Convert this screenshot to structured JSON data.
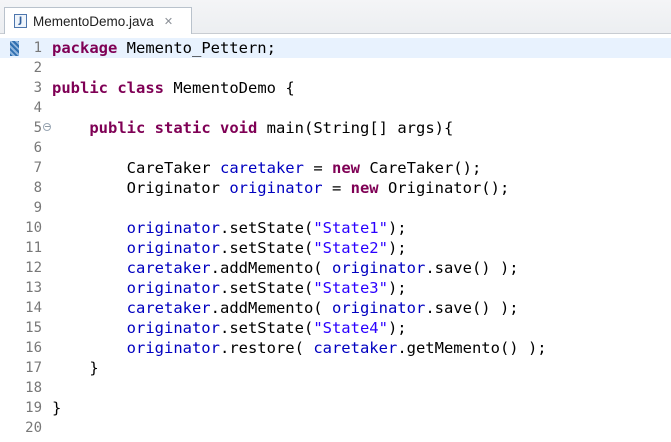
{
  "tab": {
    "icon_letter": "J",
    "title": "MementoDemo.java",
    "close_glyph": "✕"
  },
  "editor": {
    "current_line": 1,
    "fold_glyph": "⊖",
    "lines": [
      {
        "num": "1",
        "tokens": [
          {
            "t": "package",
            "c": "kw"
          },
          {
            "t": " Memento_Pettern;",
            "c": ""
          }
        ]
      },
      {
        "num": "2",
        "tokens": []
      },
      {
        "num": "3",
        "tokens": [
          {
            "t": "public",
            "c": "kw"
          },
          {
            "t": " ",
            "c": ""
          },
          {
            "t": "class",
            "c": "kw"
          },
          {
            "t": " MementoDemo {",
            "c": ""
          }
        ]
      },
      {
        "num": "4",
        "tokens": []
      },
      {
        "num": "5",
        "fold": true,
        "tokens": [
          {
            "t": "    ",
            "c": ""
          },
          {
            "t": "public",
            "c": "kw"
          },
          {
            "t": " ",
            "c": ""
          },
          {
            "t": "static",
            "c": "kw"
          },
          {
            "t": " ",
            "c": ""
          },
          {
            "t": "void",
            "c": "kw"
          },
          {
            "t": " main(String[] args){",
            "c": ""
          }
        ]
      },
      {
        "num": "6",
        "tokens": []
      },
      {
        "num": "7",
        "tokens": [
          {
            "t": "        CareTaker ",
            "c": ""
          },
          {
            "t": "caretaker",
            "c": "fld"
          },
          {
            "t": " = ",
            "c": ""
          },
          {
            "t": "new",
            "c": "kw"
          },
          {
            "t": " CareTaker();",
            "c": ""
          }
        ]
      },
      {
        "num": "8",
        "tokens": [
          {
            "t": "        Originator ",
            "c": ""
          },
          {
            "t": "originator",
            "c": "fld"
          },
          {
            "t": " = ",
            "c": ""
          },
          {
            "t": "new",
            "c": "kw"
          },
          {
            "t": " Originator();",
            "c": ""
          }
        ]
      },
      {
        "num": "9",
        "tokens": []
      },
      {
        "num": "10",
        "tokens": [
          {
            "t": "        ",
            "c": ""
          },
          {
            "t": "originator",
            "c": "fld"
          },
          {
            "t": ".setState(",
            "c": ""
          },
          {
            "t": "\"State1\"",
            "c": "str"
          },
          {
            "t": ");",
            "c": ""
          }
        ]
      },
      {
        "num": "11",
        "tokens": [
          {
            "t": "        ",
            "c": ""
          },
          {
            "t": "originator",
            "c": "fld"
          },
          {
            "t": ".setState(",
            "c": ""
          },
          {
            "t": "\"State2\"",
            "c": "str"
          },
          {
            "t": ");",
            "c": ""
          }
        ]
      },
      {
        "num": "12",
        "tokens": [
          {
            "t": "        ",
            "c": ""
          },
          {
            "t": "caretaker",
            "c": "fld"
          },
          {
            "t": ".addMemento( ",
            "c": ""
          },
          {
            "t": "originator",
            "c": "fld"
          },
          {
            "t": ".save() );",
            "c": ""
          }
        ]
      },
      {
        "num": "13",
        "tokens": [
          {
            "t": "        ",
            "c": ""
          },
          {
            "t": "originator",
            "c": "fld"
          },
          {
            "t": ".setState(",
            "c": ""
          },
          {
            "t": "\"State3\"",
            "c": "str"
          },
          {
            "t": ");",
            "c": ""
          }
        ]
      },
      {
        "num": "14",
        "tokens": [
          {
            "t": "        ",
            "c": ""
          },
          {
            "t": "caretaker",
            "c": "fld"
          },
          {
            "t": ".addMemento( ",
            "c": ""
          },
          {
            "t": "originator",
            "c": "fld"
          },
          {
            "t": ".save() );",
            "c": ""
          }
        ]
      },
      {
        "num": "15",
        "tokens": [
          {
            "t": "        ",
            "c": ""
          },
          {
            "t": "originator",
            "c": "fld"
          },
          {
            "t": ".setState(",
            "c": ""
          },
          {
            "t": "\"State4\"",
            "c": "str"
          },
          {
            "t": ");",
            "c": ""
          }
        ]
      },
      {
        "num": "16",
        "tokens": [
          {
            "t": "        ",
            "c": ""
          },
          {
            "t": "originator",
            "c": "fld"
          },
          {
            "t": ".restore( ",
            "c": ""
          },
          {
            "t": "caretaker",
            "c": "fld"
          },
          {
            "t": ".getMemento() );",
            "c": ""
          }
        ]
      },
      {
        "num": "17",
        "tokens": [
          {
            "t": "    }",
            "c": ""
          }
        ]
      },
      {
        "num": "18",
        "tokens": []
      },
      {
        "num": "19",
        "tokens": [
          {
            "t": "}",
            "c": ""
          }
        ]
      },
      {
        "num": "20",
        "tokens": []
      }
    ]
  },
  "colors": {
    "keyword": "#7f0055",
    "field": "#0000c0",
    "string": "#2a00ff",
    "line_number": "#787878",
    "current_line_bg": "#e8f2fe"
  }
}
